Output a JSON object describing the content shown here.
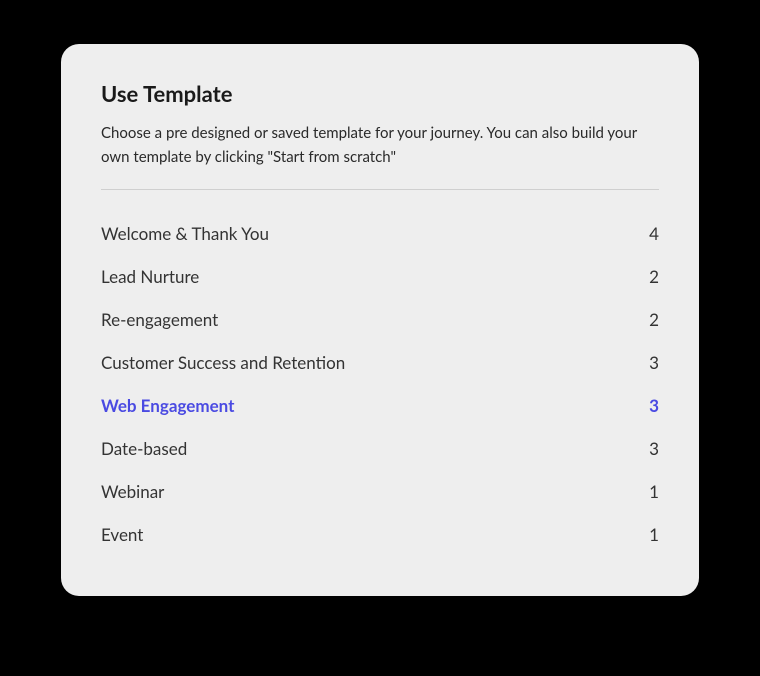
{
  "modal": {
    "title": "Use Template",
    "description": "Choose a pre designed or saved template for your journey. You can also build your own template by clicking \"Start from scratch\""
  },
  "categories": [
    {
      "label": "Welcome & Thank You",
      "count": "4",
      "selected": false
    },
    {
      "label": "Lead Nurture",
      "count": "2",
      "selected": false
    },
    {
      "label": "Re-engagement",
      "count": "2",
      "selected": false
    },
    {
      "label": "Customer Success and Retention",
      "count": "3",
      "selected": false
    },
    {
      "label": "Web Engagement",
      "count": "3",
      "selected": true
    },
    {
      "label": "Date-based",
      "count": "3",
      "selected": false
    },
    {
      "label": "Webinar",
      "count": "1",
      "selected": false
    },
    {
      "label": "Event",
      "count": "1",
      "selected": false
    }
  ]
}
